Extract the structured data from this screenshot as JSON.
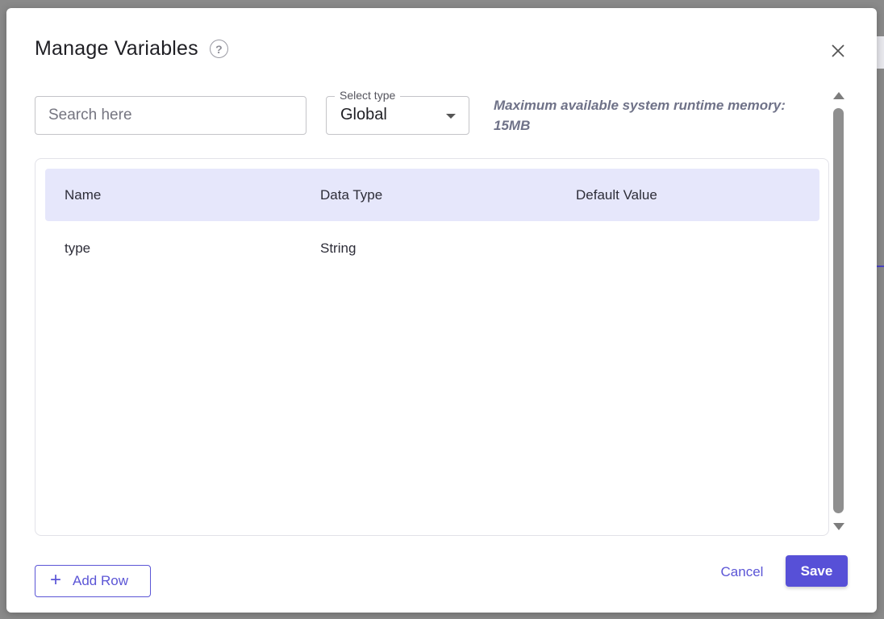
{
  "dialog": {
    "title": "Manage Variables"
  },
  "filters": {
    "search_placeholder": "Search here",
    "select_label": "Select type",
    "select_value": "Global"
  },
  "memory_note": "Maximum available system runtime memory: 15MB",
  "table": {
    "headers": [
      "Name",
      "Data Type",
      "Default Value"
    ],
    "rows": [
      {
        "name": "type",
        "data_type": "String",
        "default_value": ""
      }
    ]
  },
  "footer": {
    "add_row_label": "Add Row",
    "cancel_label": "Cancel",
    "save_label": "Save"
  },
  "colors": {
    "accent": "#5750d7",
    "header_bg": "#e6e7fb"
  }
}
